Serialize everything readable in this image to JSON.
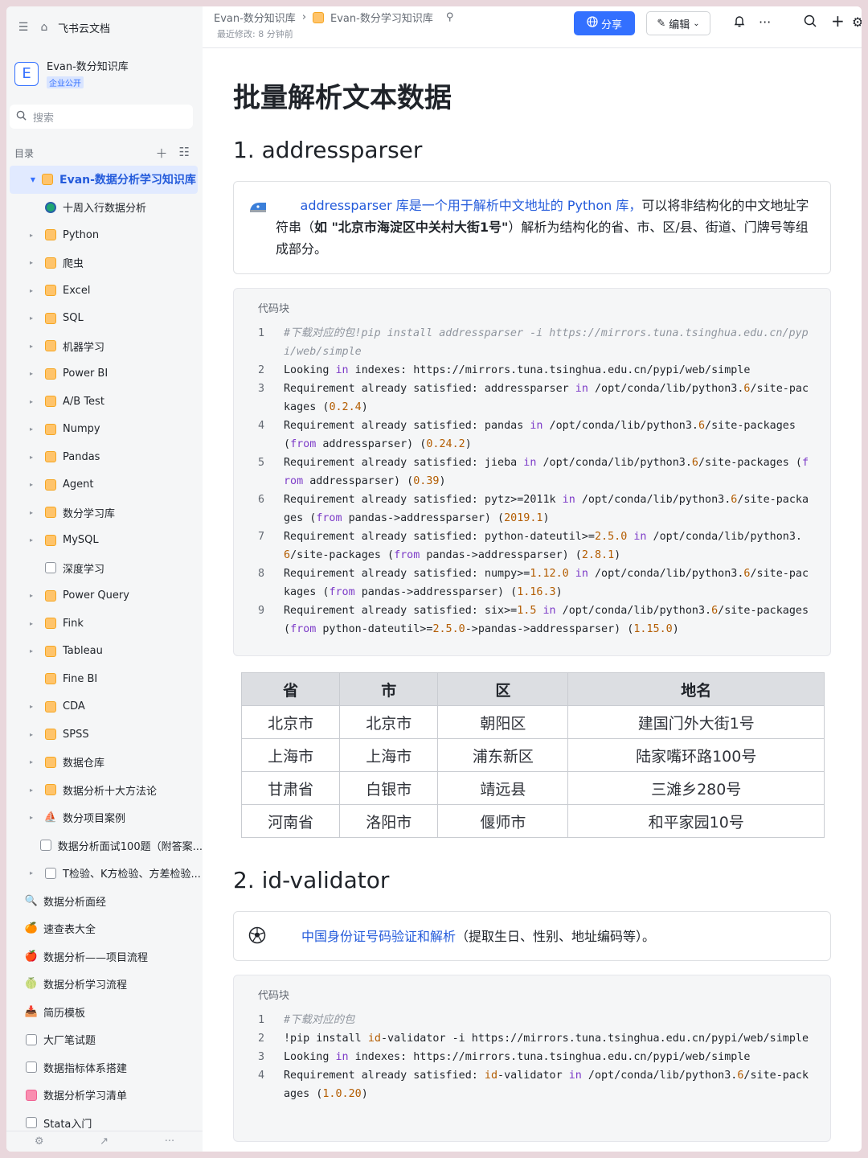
{
  "sidebar": {
    "brand": "飞书云文档",
    "kb_logo": "E",
    "kb_name": "Evan-数分知识库",
    "kb_badge": "企业公开",
    "search_placeholder": "搜索",
    "toc_label": "目录",
    "root": "Evan-数据分析学习知识库",
    "items": [
      {
        "label": "十周入行数据分析",
        "icon": "globe-icon",
        "arrow": false
      },
      {
        "label": "Python",
        "icon": "folder-icon",
        "arrow": true
      },
      {
        "label": "爬虫",
        "icon": "folder-icon",
        "arrow": true
      },
      {
        "label": "Excel",
        "icon": "folder-icon",
        "arrow": true
      },
      {
        "label": "SQL",
        "icon": "folder-icon",
        "arrow": true
      },
      {
        "label": "机器学习",
        "icon": "folder-icon",
        "arrow": true
      },
      {
        "label": "Power BI",
        "icon": "folder-icon",
        "arrow": true
      },
      {
        "label": "A/B Test",
        "icon": "folder-icon",
        "arrow": true
      },
      {
        "label": "Numpy",
        "icon": "folder-icon",
        "arrow": true
      },
      {
        "label": "Pandas",
        "icon": "folder-icon",
        "arrow": true
      },
      {
        "label": "Agent",
        "icon": "folder-icon",
        "arrow": true
      },
      {
        "label": "数分学习库",
        "icon": "folder-icon",
        "arrow": true
      },
      {
        "label": "MySQL",
        "icon": "folder-icon",
        "arrow": true
      },
      {
        "label": "深度学习",
        "icon": "doc-icon",
        "arrow": false
      },
      {
        "label": "Power Query",
        "icon": "folder-icon",
        "arrow": true
      },
      {
        "label": "Fink",
        "icon": "folder-icon",
        "arrow": true
      },
      {
        "label": "Tableau",
        "icon": "folder-icon",
        "arrow": true
      },
      {
        "label": "Fine BI",
        "icon": "folder-icon",
        "arrow": false
      },
      {
        "label": "CDA",
        "icon": "folder-icon",
        "arrow": true
      },
      {
        "label": "SPSS",
        "icon": "folder-icon",
        "arrow": true
      },
      {
        "label": "数据仓库",
        "icon": "folder-icon",
        "arrow": true
      },
      {
        "label": "数据分析十大方法论",
        "icon": "folder-icon",
        "arrow": true
      },
      {
        "label": "数分项目案例",
        "icon": "ship-icon",
        "arrow": true
      },
      {
        "label": "数据分析面试100题（附答案...",
        "icon": "doc-icon",
        "arrow": false
      },
      {
        "label": "T检验、K方检验、方差检验...",
        "icon": "doc-icon",
        "arrow": true
      }
    ],
    "top_items": [
      {
        "label": "数据分析面经",
        "icon": "magnifier-icon",
        "glyph": "🔍"
      },
      {
        "label": "速查表大全",
        "icon": "orange-icon",
        "glyph": "🍊"
      },
      {
        "label": "数据分析——项目流程",
        "icon": "apple-icon",
        "glyph": "🍎"
      },
      {
        "label": "数据分析学习流程",
        "icon": "melon-icon",
        "glyph": "🍈"
      },
      {
        "label": "简历模板",
        "icon": "inbox-icon",
        "glyph": "📥"
      },
      {
        "label": "大厂笔试题",
        "icon": "doc-icon",
        "glyph": ""
      },
      {
        "label": "数据指标体系搭建",
        "icon": "doc-icon",
        "glyph": ""
      },
      {
        "label": "数据分析学习清单",
        "icon": "pink-doc-icon",
        "glyph": ""
      },
      {
        "label": "Stata入门",
        "icon": "doc-icon",
        "glyph": ""
      }
    ]
  },
  "topbar": {
    "breadcrumb_1": "Evan-数分知识库",
    "breadcrumb_sep": "›",
    "breadcrumb_2": "Evan-数分学习知识库",
    "modified": "最近修改: 8 分钟前",
    "share": "分享",
    "edit": "编辑"
  },
  "doc": {
    "title": "批量解析文本数据",
    "sec1": "1. addressparser",
    "callout1_link": "addressparser 库是一个用于解析中文地址的 Python 库，",
    "callout1_text": "可以将非结构化的中文地址字符串（",
    "callout1_bold": "如 \"北京市海淀区中关村大街1号\"",
    "callout1_tail": "）解析为结构化的省、市、区/县、街道、门牌号等组成部分。",
    "code_caption": "代码块",
    "sec2": "2. id-validator",
    "callout2_link": "中国身份证号码验证和解析",
    "callout2_text": "（提取生日、性别、地址编码等）。"
  },
  "code1": [
    {
      "n": "1",
      "html": "<span class=\"cm\">#下载对应的包!pip install addressparser -i https://mirrors.tuna.tsinghua.edu.cn/pypi/web/simple</span>"
    },
    {
      "n": "2",
      "html": "Looking <span class=\"kw\">in</span> indexes: https://mirrors.tuna.tsinghua.edu.cn/pypi/web/simple"
    },
    {
      "n": "3",
      "html": "Requirement already satisfied: addressparser <span class=\"kw\">in</span> /opt/conda/lib/python3.<span class=\"nm\">6</span>/site-packages (<span class=\"nm\">0.2.4</span>)"
    },
    {
      "n": "4",
      "html": "Requirement already satisfied: pandas <span class=\"kw\">in</span> /opt/conda/lib/python3.<span class=\"nm\">6</span>/site-packages (<span class=\"kw\">from</span> addressparser) (<span class=\"nm\">0.24.2</span>)"
    },
    {
      "n": "5",
      "html": "Requirement already satisfied: jieba <span class=\"kw\">in</span> /opt/conda/lib/python3.<span class=\"nm\">6</span>/site-packages (<span class=\"kw\">from</span> addressparser) (<span class=\"nm\">0.39</span>)"
    },
    {
      "n": "6",
      "html": "Requirement already satisfied: pytz>=2011k <span class=\"kw\">in</span> /opt/conda/lib/python3.<span class=\"nm\">6</span>/site-packages (<span class=\"kw\">from</span> pandas->addressparser) (<span class=\"nm\">2019.1</span>)"
    },
    {
      "n": "7",
      "html": "Requirement already satisfied: python-dateutil>=<span class=\"nm\">2.5.0</span> <span class=\"kw\">in</span> /opt/conda/lib/python3.<span class=\"nm\">6</span>/site-packages (<span class=\"kw\">from</span> pandas->addressparser) (<span class=\"nm\">2.8.1</span>)"
    },
    {
      "n": "8",
      "html": "Requirement already satisfied: numpy>=<span class=\"nm\">1.12.0</span> <span class=\"kw\">in</span> /opt/conda/lib/python3.<span class=\"nm\">6</span>/site-packages (<span class=\"kw\">from</span> pandas->addressparser) (<span class=\"nm\">1.16.3</span>)"
    },
    {
      "n": "9",
      "html": "Requirement already satisfied: six>=<span class=\"nm\">1.5</span> <span class=\"kw\">in</span> /opt/conda/lib/python3.<span class=\"nm\">6</span>/site-packages (<span class=\"kw\">from</span> python-dateutil>=<span class=\"nm\">2.5.0</span>->pandas->addressparser) (<span class=\"nm\">1.15.0</span>)"
    }
  ],
  "table": {
    "headers": [
      "省",
      "市",
      "区",
      "地名"
    ],
    "rows": [
      [
        "北京市",
        "北京市",
        "朝阳区",
        "建国门外大街1号"
      ],
      [
        "上海市",
        "上海市",
        "浦东新区",
        "陆家嘴环路100号"
      ],
      [
        "甘肃省",
        "白银市",
        "靖远县",
        "三滩乡280号"
      ],
      [
        "河南省",
        "洛阳市",
        "偃师市",
        "和平家园10号"
      ]
    ]
  },
  "code2": [
    {
      "n": "1",
      "html": "<span class=\"cm\">#下载对应的包</span>"
    },
    {
      "n": "2",
      "html": "!pip install <span class=\"nm\">id</span>-validator -i https://mirrors.tuna.tsinghua.edu.cn/pypi/web/simple"
    },
    {
      "n": "3",
      "html": "Looking <span class=\"kw\">in</span> indexes: https://mirrors.tuna.tsinghua.edu.cn/pypi/web/simple"
    },
    {
      "n": "4",
      "html": "Requirement already satisfied: <span class=\"nm\">id</span>-validator <span class=\"kw\">in</span> /opt/conda/lib/python3.<span class=\"nm\">6</span>/site-packages (<span class=\"nm\">1.0.20</span>)"
    }
  ]
}
